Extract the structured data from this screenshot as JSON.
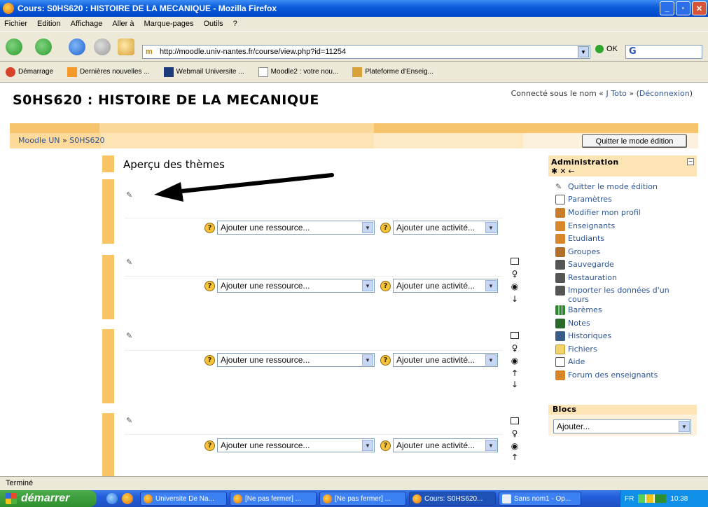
{
  "window": {
    "title": "Cours: S0HS620 : HISTOIRE DE LA MECANIQUE - Mozilla Firefox",
    "min_glyph": "_",
    "max_glyph": "▫",
    "close_glyph": "✕"
  },
  "menu": [
    "Fichier",
    "Edition",
    "Affichage",
    "Aller à",
    "Marque-pages",
    "Outils",
    "?"
  ],
  "toolbar": {
    "url": "http://moodle.univ-nantes.fr/course/view.php?id=11254",
    "go_label": "OK",
    "search_glyph": "G"
  },
  "bookmarks": [
    "Démarrage",
    "Dernières nouvelles ...",
    "Webmail Universite ...",
    "Moodle2 : votre nou...",
    "Plateforme d'Enseig..."
  ],
  "course": {
    "title": "S0HS620 : HISTOIRE DE LA MECANIQUE",
    "login_prefix": "Connecté sous le nom « ",
    "login_user": "J Toto",
    "login_mid": " » (",
    "logout": "Déconnexion",
    "login_suffix": ")"
  },
  "breadcrumb": {
    "home": "Moodle UN",
    "sep": " » ",
    "current": "S0HS620"
  },
  "quit_edit_button": "Quitter le mode édition",
  "sections": {
    "overview_title": "Aperçu des thèmes",
    "add_resource": "Ajouter une ressource...",
    "add_activity": "Ajouter une activité..."
  },
  "admin": {
    "title": "Administration",
    "hide_glyph": "−",
    "ctrls": "✱✕←",
    "items": [
      "Quitter le mode édition",
      "Paramètres",
      "Modifier mon profil",
      "Enseignants",
      "Etudiants",
      "Groupes",
      "Sauvegarde",
      "Restauration",
      "Importer les données d'un cours",
      "Barèmes",
      "Notes",
      "Historiques",
      "Fichiers",
      "Aide",
      "Forum des enseignants"
    ]
  },
  "blocs": {
    "title": "Blocs",
    "select_value": "Ajouter..."
  },
  "status": "Terminé",
  "taskbar": {
    "start": "démarrer",
    "tasks": [
      "Universite De Na...",
      "[Ne pas fermer] ...",
      "[Ne pas fermer] ...",
      "Cours: S0HS620...",
      "Sans nom1 - Op..."
    ],
    "lang": "FR",
    "clock": "10:38"
  },
  "icons": {
    "edit": "edit-icon",
    "help": "help-icon",
    "show": "show-icon",
    "hide": "eye-icon",
    "move_up": "arrow-up-icon",
    "move_down": "arrow-down-icon",
    "highlight": "lightbulb-icon",
    "unhighlight": "square-icon"
  }
}
